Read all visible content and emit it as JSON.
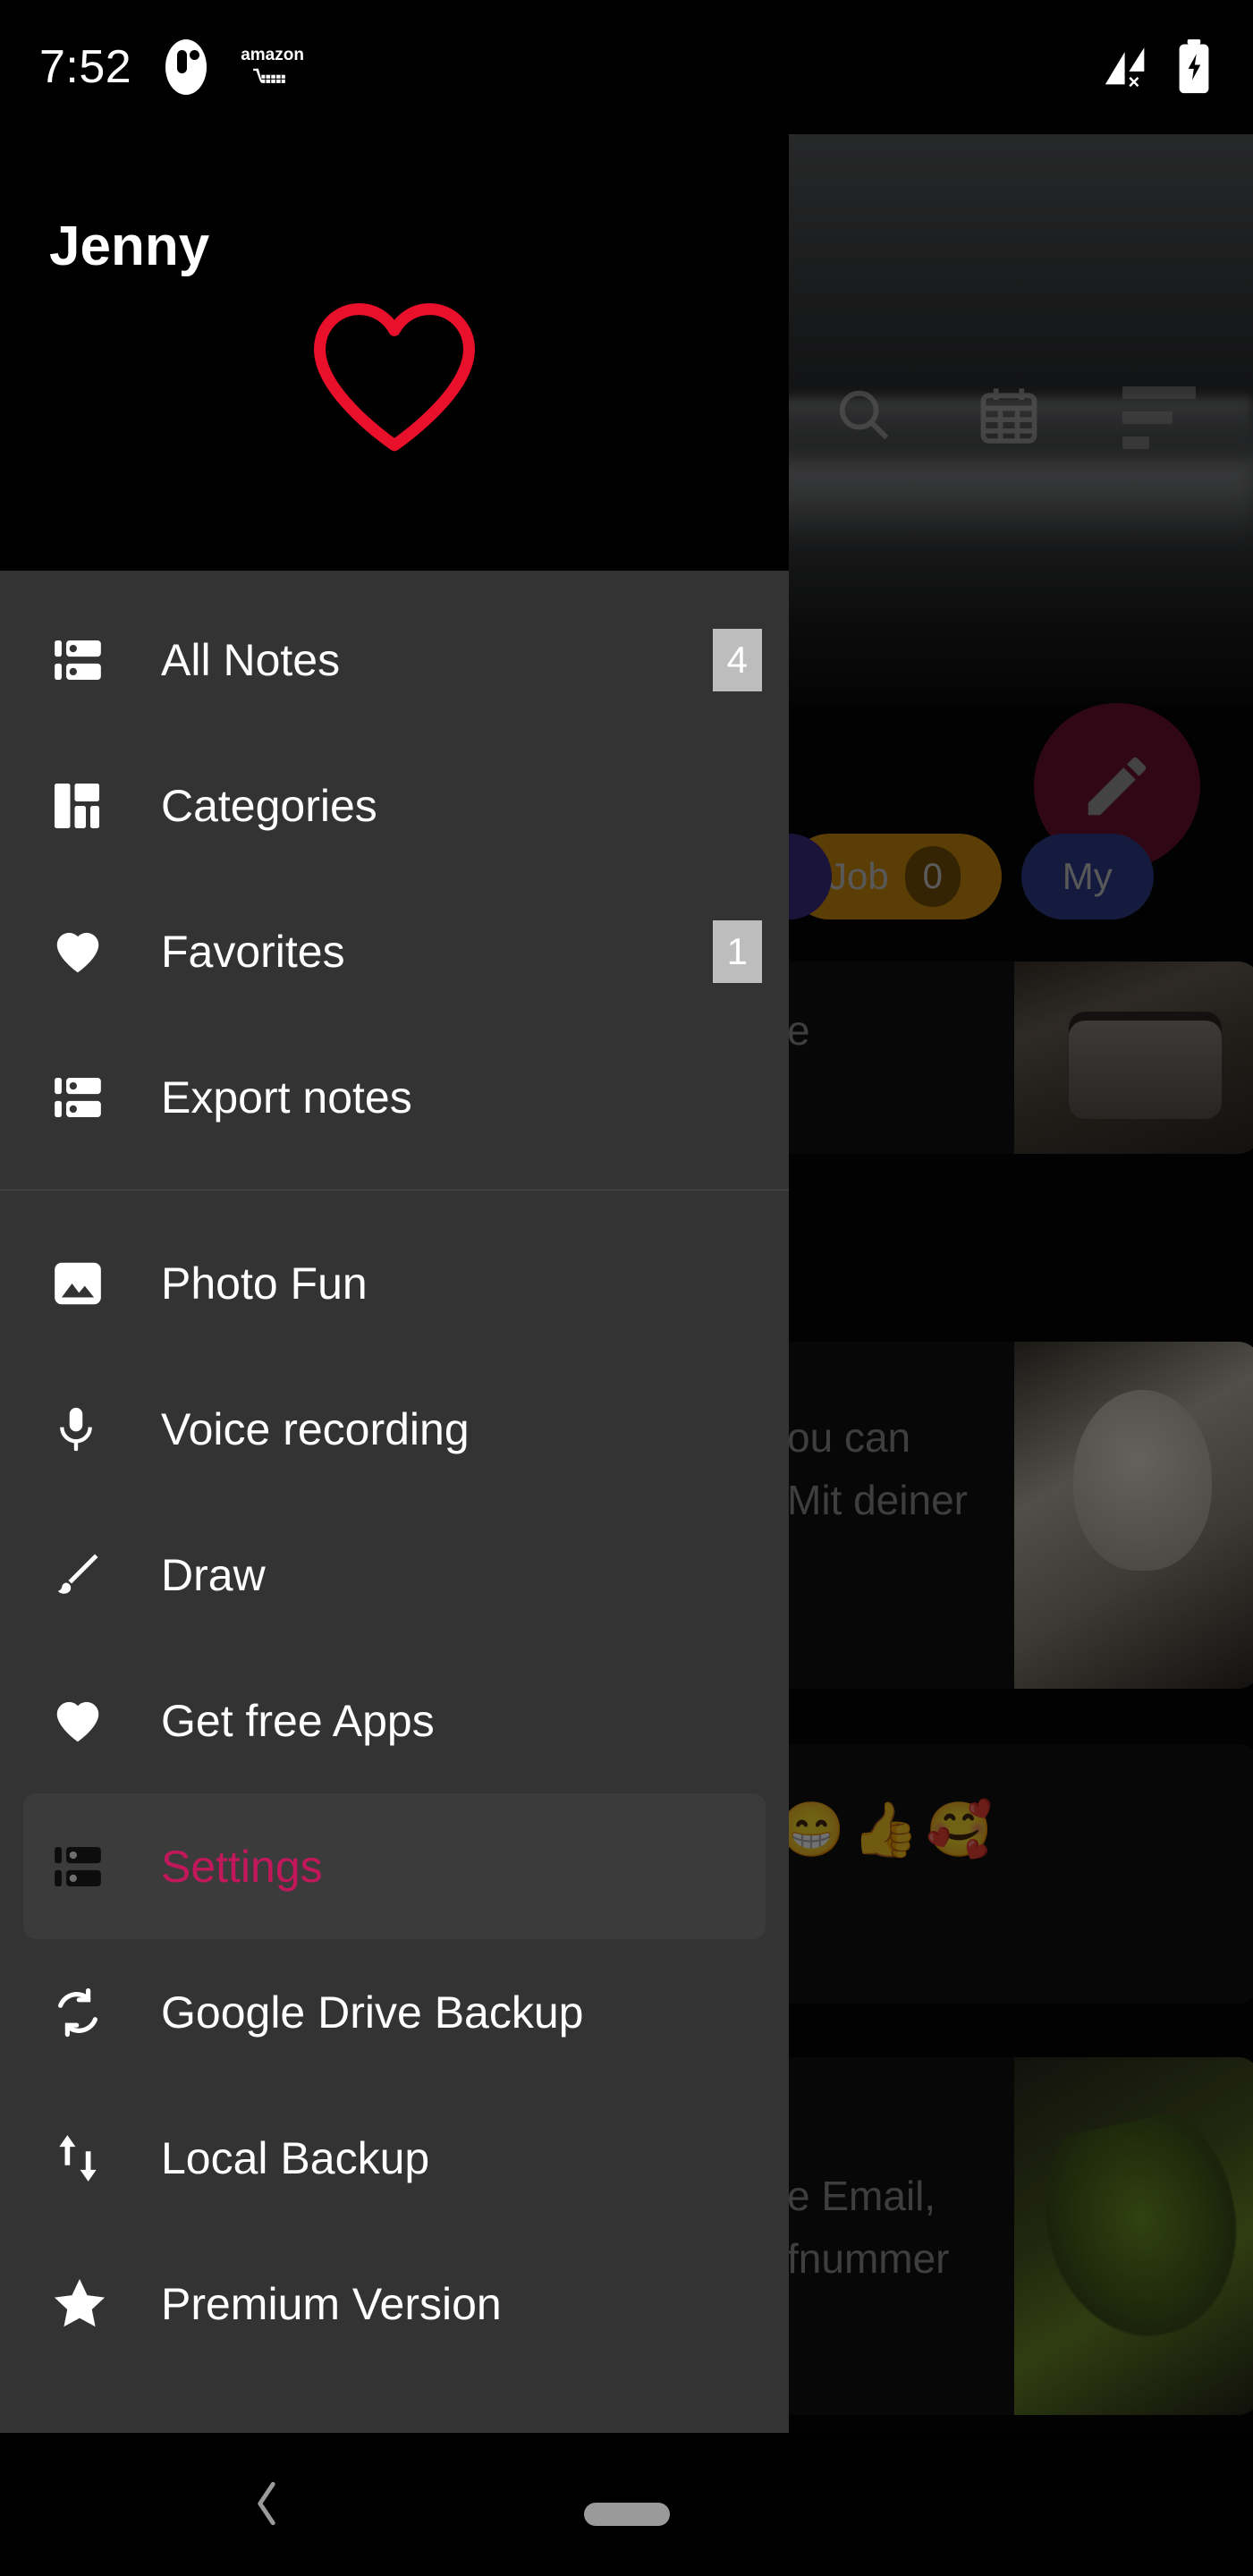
{
  "status_bar": {
    "time": "7:52",
    "app_icon_name": "oval-app-icon",
    "amazon_label": "amazon",
    "signal_icon_name": "signal-no-sim-icon",
    "battery_icon_name": "battery-charging-icon"
  },
  "drawer": {
    "user_name": "Jenny",
    "logo_name": "heart-logo",
    "accent_color": "#e8102a",
    "selected_color": "#c2185b",
    "background_color": "#333333",
    "groups": [
      {
        "items": [
          {
            "label": "All Notes",
            "icon": "list-icon",
            "badge": "4"
          },
          {
            "label": "Categories",
            "icon": "dashboard-icon",
            "badge": null
          },
          {
            "label": "Favorites",
            "icon": "heart-filled-icon",
            "badge": "1"
          },
          {
            "label": "Export notes",
            "icon": "list-icon",
            "badge": null
          }
        ]
      },
      {
        "items": [
          {
            "label": "Photo Fun",
            "icon": "image-icon",
            "badge": null
          },
          {
            "label": "Voice recording",
            "icon": "microphone-icon",
            "badge": null
          },
          {
            "label": "Draw",
            "icon": "brush-icon",
            "badge": null
          },
          {
            "label": "Get free Apps",
            "icon": "heart-filled-icon",
            "badge": null
          },
          {
            "label": "Settings",
            "icon": "list-icon",
            "badge": null,
            "selected": true
          },
          {
            "label": "Google Drive Backup",
            "icon": "sync-icon",
            "badge": null
          },
          {
            "label": "Local Backup",
            "icon": "up-down-arrows-icon",
            "badge": null
          },
          {
            "label": "Premium Version",
            "icon": "star-icon",
            "badge": null
          }
        ]
      }
    ]
  },
  "app": {
    "toolbar": {
      "search_icon": "search-icon",
      "calendar_icon": "calendar-icon",
      "sort_icon": "sort-icon"
    },
    "fab": {
      "icon": "pencil-icon",
      "color": "#6d1130"
    },
    "chips": [
      {
        "label": "",
        "count": "",
        "color": "#3d2f86"
      },
      {
        "label": "Job",
        "count": "0",
        "color": "#cf8e0d"
      },
      {
        "label": "My",
        "count": "",
        "color": "#2f3f8f"
      }
    ],
    "notes": [
      {
        "text_lines": [
          "e"
        ],
        "photo": "jar-photo"
      },
      {
        "text_lines": [
          "ou can",
          "Mit deiner"
        ],
        "photo": "dog-photo"
      },
      {
        "text_lines": [
          "😁👍🥰"
        ],
        "photo": null
      },
      {
        "text_lines": [
          "e Email,",
          "fnummer"
        ],
        "photo": "leaf-photo"
      }
    ]
  },
  "nav_bar": {
    "back_icon": "back-chevron-icon",
    "home_icon": "home-pill-icon"
  }
}
